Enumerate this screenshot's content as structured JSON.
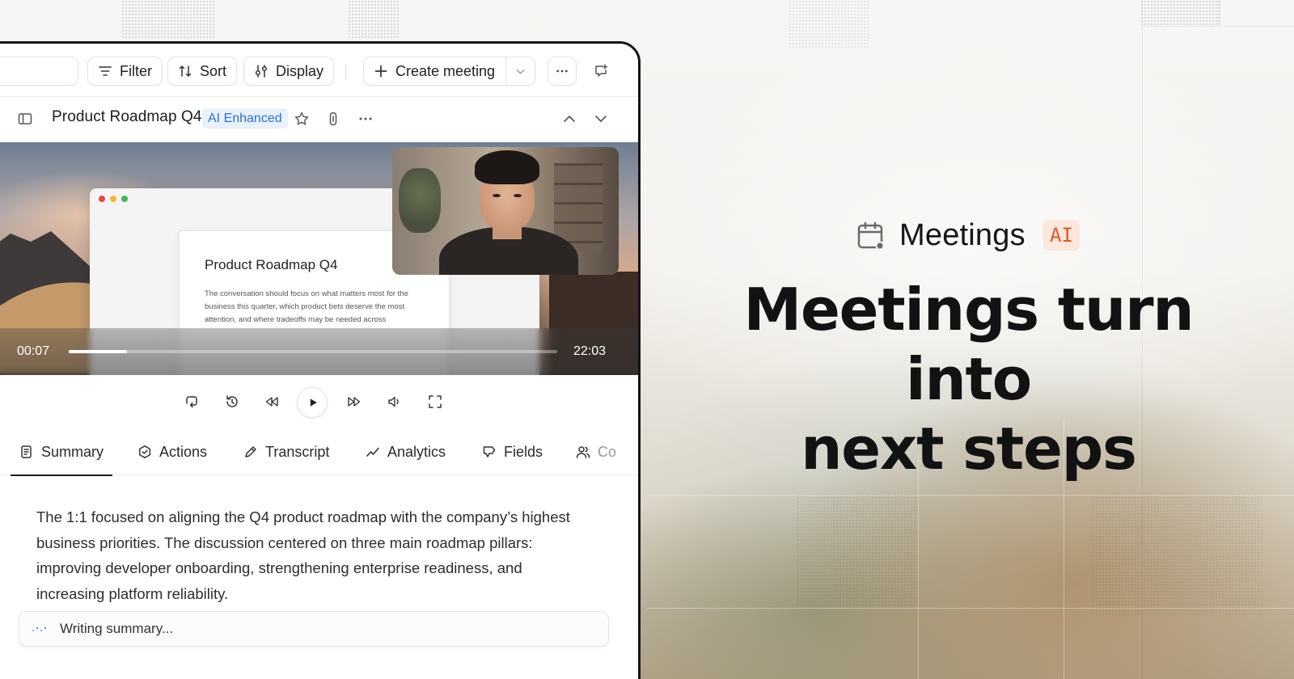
{
  "toolbar": {
    "filter_label": "Filter",
    "sort_label": "Sort",
    "display_label": "Display",
    "create_meeting_label": "Create meeting"
  },
  "meeting": {
    "title": "Product Roadmap Q4",
    "badge": "AI Enhanced"
  },
  "video": {
    "slide_title": "Product Roadmap Q4",
    "slide_body": "The conversation should focus on what matters most for the business this quarter, which product bets deserve the most attention, and where tradeoffs may be needed across",
    "current_time": "00:07",
    "duration": "22:03",
    "progress_fraction": 0.12
  },
  "tabs": [
    {
      "label": "Summary",
      "icon": "summary-doc-icon",
      "active": true
    },
    {
      "label": "Actions",
      "icon": "actions-icon",
      "active": false
    },
    {
      "label": "Transcript",
      "icon": "transcript-pen-icon",
      "active": false
    },
    {
      "label": "Analytics",
      "icon": "analytics-line-icon",
      "active": false
    },
    {
      "label": "Fields",
      "icon": "fields-tag-icon",
      "active": false
    },
    {
      "label": "Co",
      "icon": "contacts-people-icon",
      "active": false
    }
  ],
  "summary": {
    "text": "The 1:1 focused on aligning the Q4 product roadmap with the company’s highest business priorities. The discussion centered on three main roadmap pillars: improving developer onboarding, strengthening enterprise readiness, and increasing platform reliability.",
    "status": "Writing summary..."
  },
  "hero": {
    "brand": "Meetings",
    "brand_badge": "AI",
    "headline_line1": "Meetings turn into",
    "headline_line2": "next steps"
  },
  "colors": {
    "ai_badge_bg": "#e9f1fd",
    "ai_badge_text": "#2f6fd6",
    "brand_ai_bg": "#fbe7dc",
    "brand_ai_text": "#e0592a",
    "frame": "#151515"
  }
}
